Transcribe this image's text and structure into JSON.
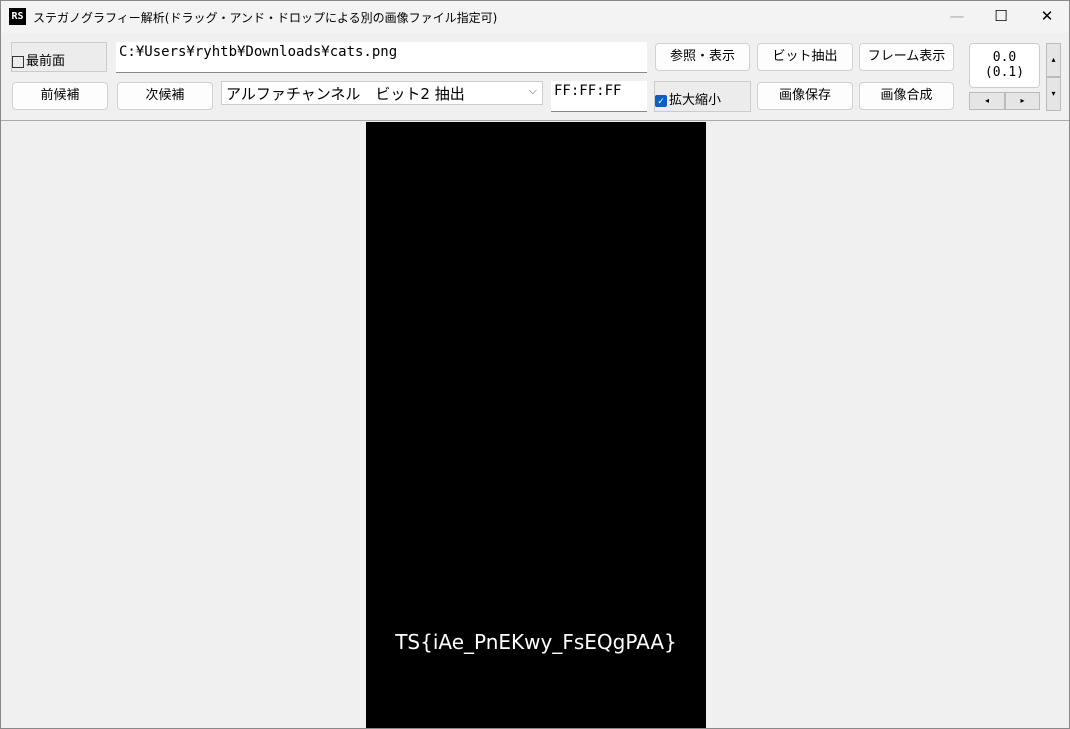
{
  "window": {
    "title": "ステガノグラフィー解析(ドラッグ・アンド・ドロップによる別の画像ファイル指定可)",
    "logo": "RS"
  },
  "toolbar": {
    "topmost_label": "最前面",
    "topmost_checked": false,
    "path": "C:¥Users¥ryhtb¥Downloads¥cats.png",
    "prev": "前候補",
    "next": "次候補",
    "mode": "アルファチャンネル　ビット2 抽出",
    "color": "FF:FF:FF",
    "browse": "参照・表示",
    "bit_extract": "ビット抽出",
    "frame_show": "フレーム表示",
    "zoom_label": "拡大縮小",
    "zoom_checked": true,
    "save": "画像保存",
    "compose": "画像合成",
    "value": "0.0",
    "value_sub": "(0.1)"
  },
  "image": {
    "text": "TS{iAe_PnEKwy_FsEQgPAA}"
  }
}
